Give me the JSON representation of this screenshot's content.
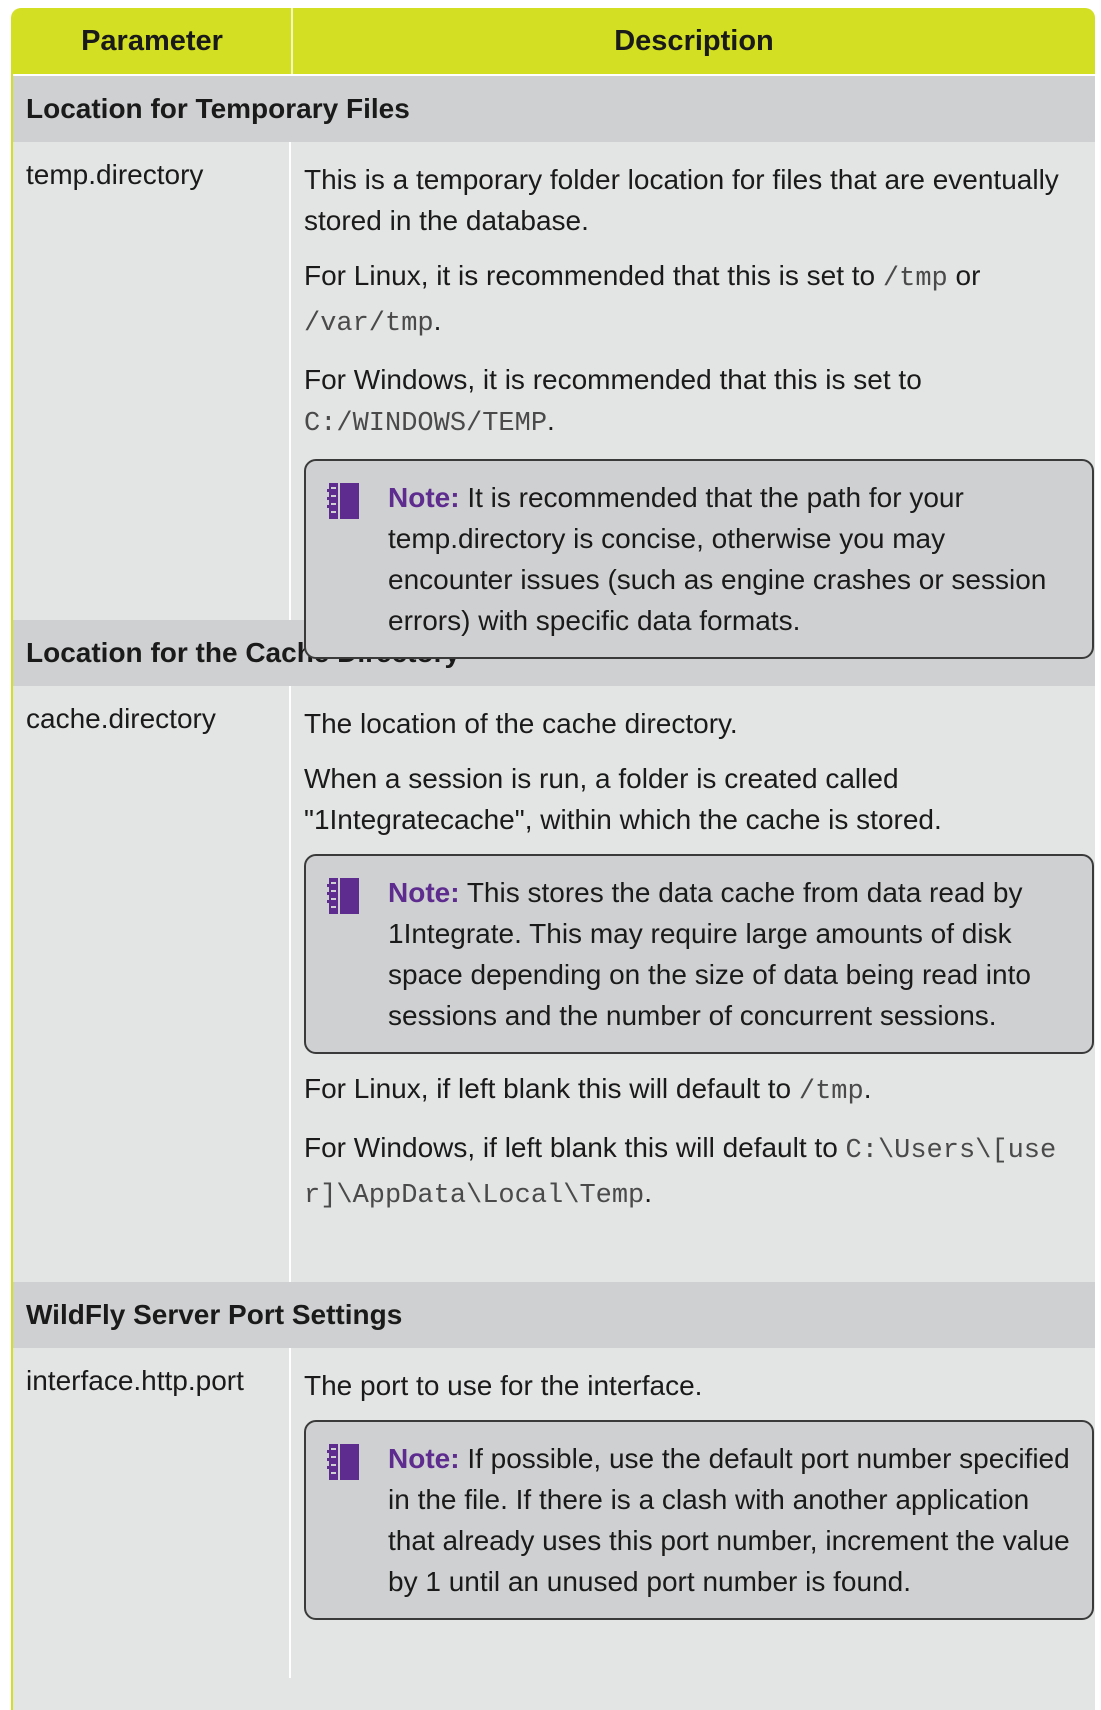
{
  "header": {
    "parameter": "Parameter",
    "description": "Description"
  },
  "sections": [
    {
      "title": "Location for Temporary Files",
      "param": "temp.directory",
      "p1": "This is a temporary folder location for files that are eventually stored in the database.",
      "p2_pre": "For Linux, it is recommended that this is set to ",
      "p2_code1": "/tmp",
      "p2_mid": " or ",
      "p2_code2": "/var/tmp",
      "p2_post": ".",
      "p3_pre": "For Windows, it is recommended that this is set to ",
      "p3_code": "C:/WINDOWS/TEMP",
      "p3_post": ".",
      "note_label": "Note:",
      "note_text": " It is recommended that the path for your temp.directory is concise, otherwise you may encounter issues (such as engine crashes or session errors) with specific data formats."
    },
    {
      "title": "Location for the Cache Directory",
      "param": "cache.directory",
      "p1": "The location of the cache directory.",
      "p2": "When a session is run, a folder is created called \"1Integratecache\", within which the cache is stored.",
      "note_label": "Note:",
      "note_text": " This stores the data cache from data read by 1Integrate. This may require large amounts of disk space depending on the size of data being read into sessions and the number of concurrent sessions.",
      "p3_pre": "For Linux, if left blank this will default to ",
      "p3_code": "/tmp",
      "p3_post": ".",
      "p4_pre": "For Windows, if left blank this will default to ",
      "p4_code": "C:\\Users\\[user]\\AppData\\Local\\Temp",
      "p4_post": "."
    },
    {
      "title": "WildFly Server Port Settings",
      "param": "interface.http.port",
      "p1": "The port to use for the interface.",
      "note_label": "Note:",
      "note_text": " If possible, use the default port number specified in the file. If there is a clash with another application that already uses this port number, increment the value by 1 until an unused port number is found."
    }
  ],
  "colors": {
    "header_bg": "#d3df22",
    "section_bg": "#cfd0d1",
    "row_bg": "#e3e4e4",
    "note_label": "#5e2b8f"
  },
  "icons": {
    "note": "notebook-icon"
  }
}
